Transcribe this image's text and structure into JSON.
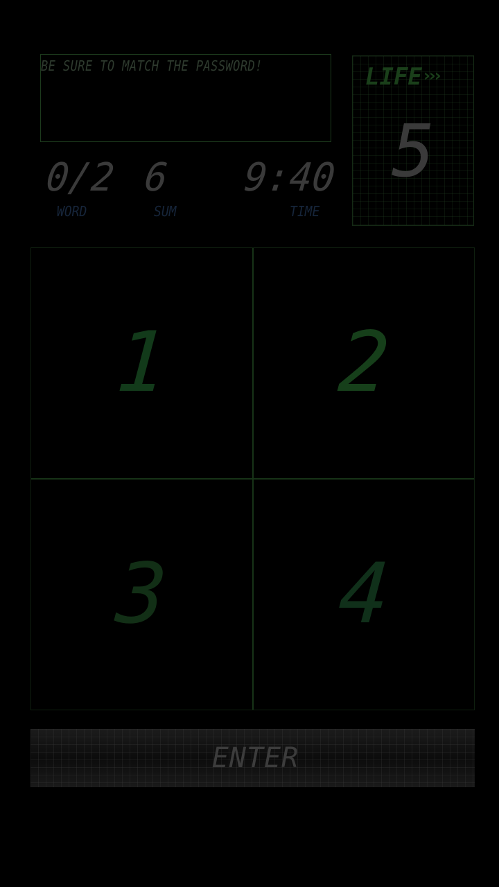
{
  "message": "BE SURE TO MATCH THE PASSWORD!",
  "stats": {
    "word": {
      "value": "0/2",
      "label": "WORD"
    },
    "sum": {
      "value": "6",
      "label": "SUM"
    },
    "time": {
      "value": "9:40",
      "label": "TIME"
    }
  },
  "life": {
    "title": "LIFE",
    "arrows": "›››",
    "value": "5"
  },
  "keypad": {
    "keys": [
      "1",
      "2",
      "3",
      "4"
    ]
  },
  "enter_label": "ENTER",
  "colors": {
    "background": "#000000",
    "key_digit_1": "#123a1a",
    "key_digit_2": "#163f1a",
    "key_digit_3": "#122f16",
    "key_digit_4": "#10301a",
    "grid_line": "#173317",
    "label_blue": "#16253a",
    "value_gray": "#3a3a3a"
  }
}
